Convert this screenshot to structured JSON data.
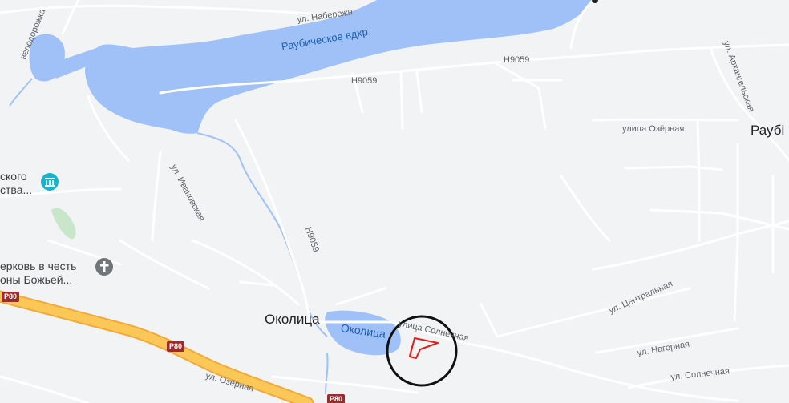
{
  "map": {
    "water": {
      "reservoir": "Раубическое вдхр.",
      "pond": "Околица"
    },
    "places": {
      "village": "Околица",
      "town_partial": "Раубі"
    },
    "roads": {
      "embankment_street": "ул. Набережн",
      "bike_path": "велодорожка",
      "highway_h9059_a": "Н9059",
      "highway_h9059_b": "Н9059",
      "highway_h9059_c": "Н9059",
      "ivanovskaya": "ул. Ивановская",
      "arkhangelskaya": "ул. Архангельская",
      "ozernaya_street_ne": "улица Озёрная",
      "tsentralnaya": "ул. Центральная",
      "nagornaya": "ул. Нагорная",
      "solnechnaya_street": "улица Солнечная",
      "solnechnaya_ul": "ул. Солнечная",
      "ozernaya_south": "ул. Озёрная"
    },
    "route_shields": {
      "p80_west": "Р80",
      "p80_mid": "Р80",
      "p80_south": "Р80"
    },
    "pois": {
      "museum": {
        "line1": "ского",
        "line2": "ства...",
        "icon": "museum-icon"
      },
      "church": {
        "line1": "ерковь в честь",
        "line2": "оны Божьей...",
        "icon": "church-cross-icon"
      }
    },
    "marker": {
      "icon": "red-flag-marker-icon",
      "highlight": "circle-highlight"
    },
    "colors": {
      "land": "#f1f3f4",
      "water": "#a0c1f7",
      "road": "#ffffff",
      "highway": "#fbc756",
      "marker": "#e0201c",
      "poi_teal": "#12b5cb",
      "poi_gray": "#70757a"
    }
  }
}
